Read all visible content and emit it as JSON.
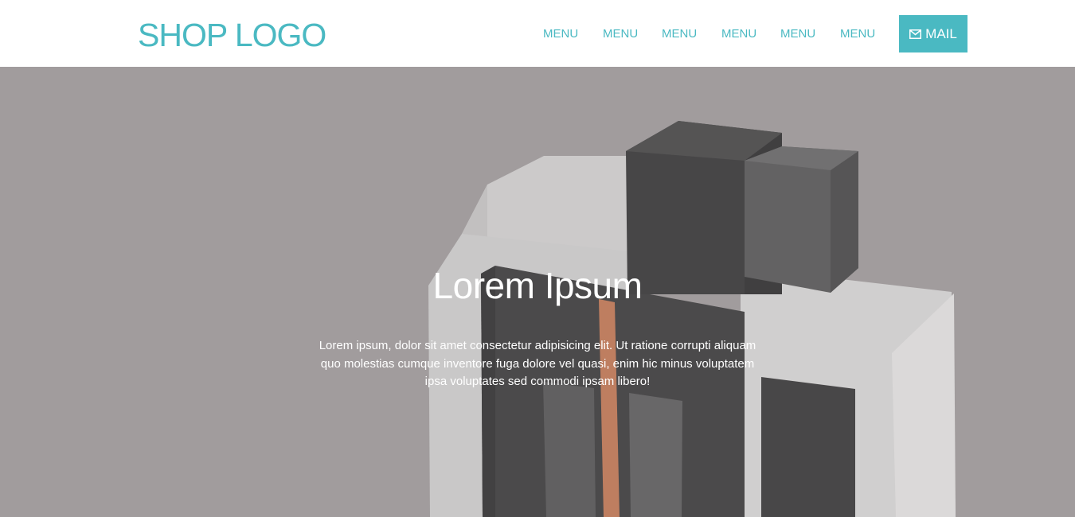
{
  "header": {
    "logo": "SHOP LOGO",
    "menu": [
      {
        "label": "MENU"
      },
      {
        "label": "MENU"
      },
      {
        "label": "MENU"
      },
      {
        "label": "MENU"
      },
      {
        "label": "MENU"
      },
      {
        "label": "MENU"
      }
    ],
    "mail_button": {
      "label": "MAIL",
      "icon": "envelope-icon"
    }
  },
  "hero": {
    "title": "Lorem Ipsum",
    "text": "Lorem ipsum, dolor sit amet consectetur adipisicing elit. Ut ratione corrupti aliquam quo molestias cumque inventore fuga dolore vel quasi, enim hic minus voluptatem ipsa voluptates sed commodi ipsam libero!"
  },
  "colors": {
    "accent": "#4ab9c2",
    "hero_background": "#a19d9e",
    "header_background": "#ffffff"
  }
}
